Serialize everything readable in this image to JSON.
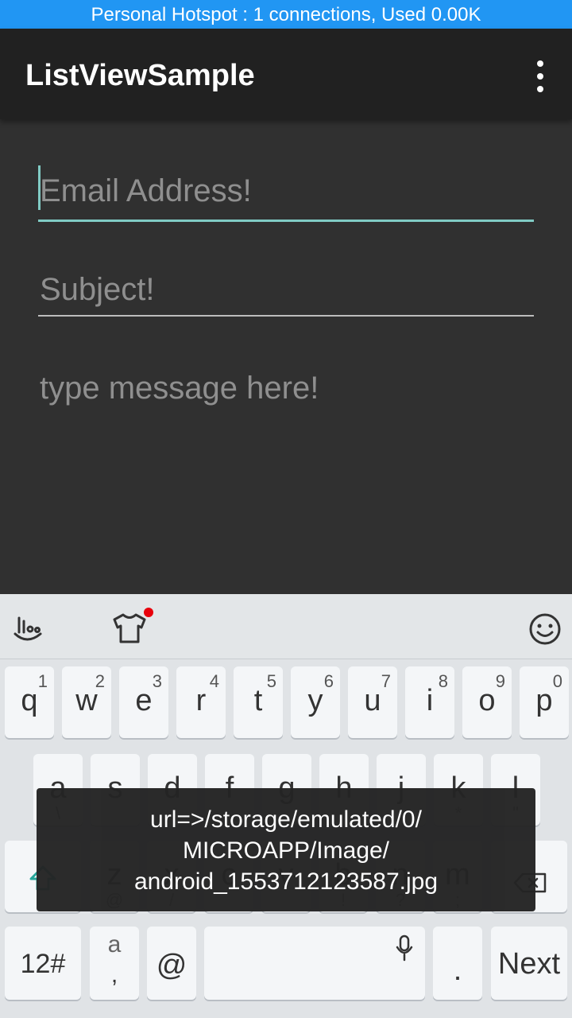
{
  "status_bar": {
    "text": "Personal Hotspot : 1 connections, Used 0.00K"
  },
  "app_bar": {
    "title": "ListViewSample"
  },
  "form": {
    "email_placeholder": "Email Address!",
    "subject_placeholder": "Subject!",
    "message_placeholder": "type message here!"
  },
  "keyboard": {
    "toolbar_icons": [
      "swype-gesture-icon",
      "theme-shirt-icon",
      "emoji-icon"
    ],
    "row1": [
      {
        "key": "q",
        "hint": "1"
      },
      {
        "key": "w",
        "hint": "2"
      },
      {
        "key": "e",
        "hint": "3"
      },
      {
        "key": "r",
        "hint": "4"
      },
      {
        "key": "t",
        "hint": "5"
      },
      {
        "key": "y",
        "hint": "6"
      },
      {
        "key": "u",
        "hint": "7"
      },
      {
        "key": "i",
        "hint": "8"
      },
      {
        "key": "o",
        "hint": "9"
      },
      {
        "key": "p",
        "hint": "0"
      }
    ],
    "row2": [
      {
        "key": "a",
        "sub": "\\"
      },
      {
        "key": "s",
        "sub": ""
      },
      {
        "key": "d",
        "sub": ""
      },
      {
        "key": "f",
        "sub": ""
      },
      {
        "key": "g",
        "sub": ""
      },
      {
        "key": "h",
        "sub": ""
      },
      {
        "key": "j",
        "sub": ""
      },
      {
        "key": "k",
        "sub": "*"
      },
      {
        "key": "l",
        "sub": "\""
      }
    ],
    "row3": [
      {
        "key": "z",
        "sub": "@"
      },
      {
        "key": "x",
        "sub": "/"
      },
      {
        "key": "c",
        "sub": ""
      },
      {
        "key": "v",
        "sub": ""
      },
      {
        "key": "b",
        "sub": "!"
      },
      {
        "key": "n",
        "sub": "?"
      },
      {
        "key": "m",
        "sub": ";"
      }
    ],
    "bottom": {
      "symbols": "12#",
      "punct_top": "a",
      "punct_bottom": ",",
      "at": "@",
      "period": ".",
      "action": "Next"
    }
  },
  "toast": {
    "line1": "url=>/storage/emulated/0/",
    "line2": "MICROAPP/Image/",
    "line3": "android_1553712123587.jpg"
  }
}
